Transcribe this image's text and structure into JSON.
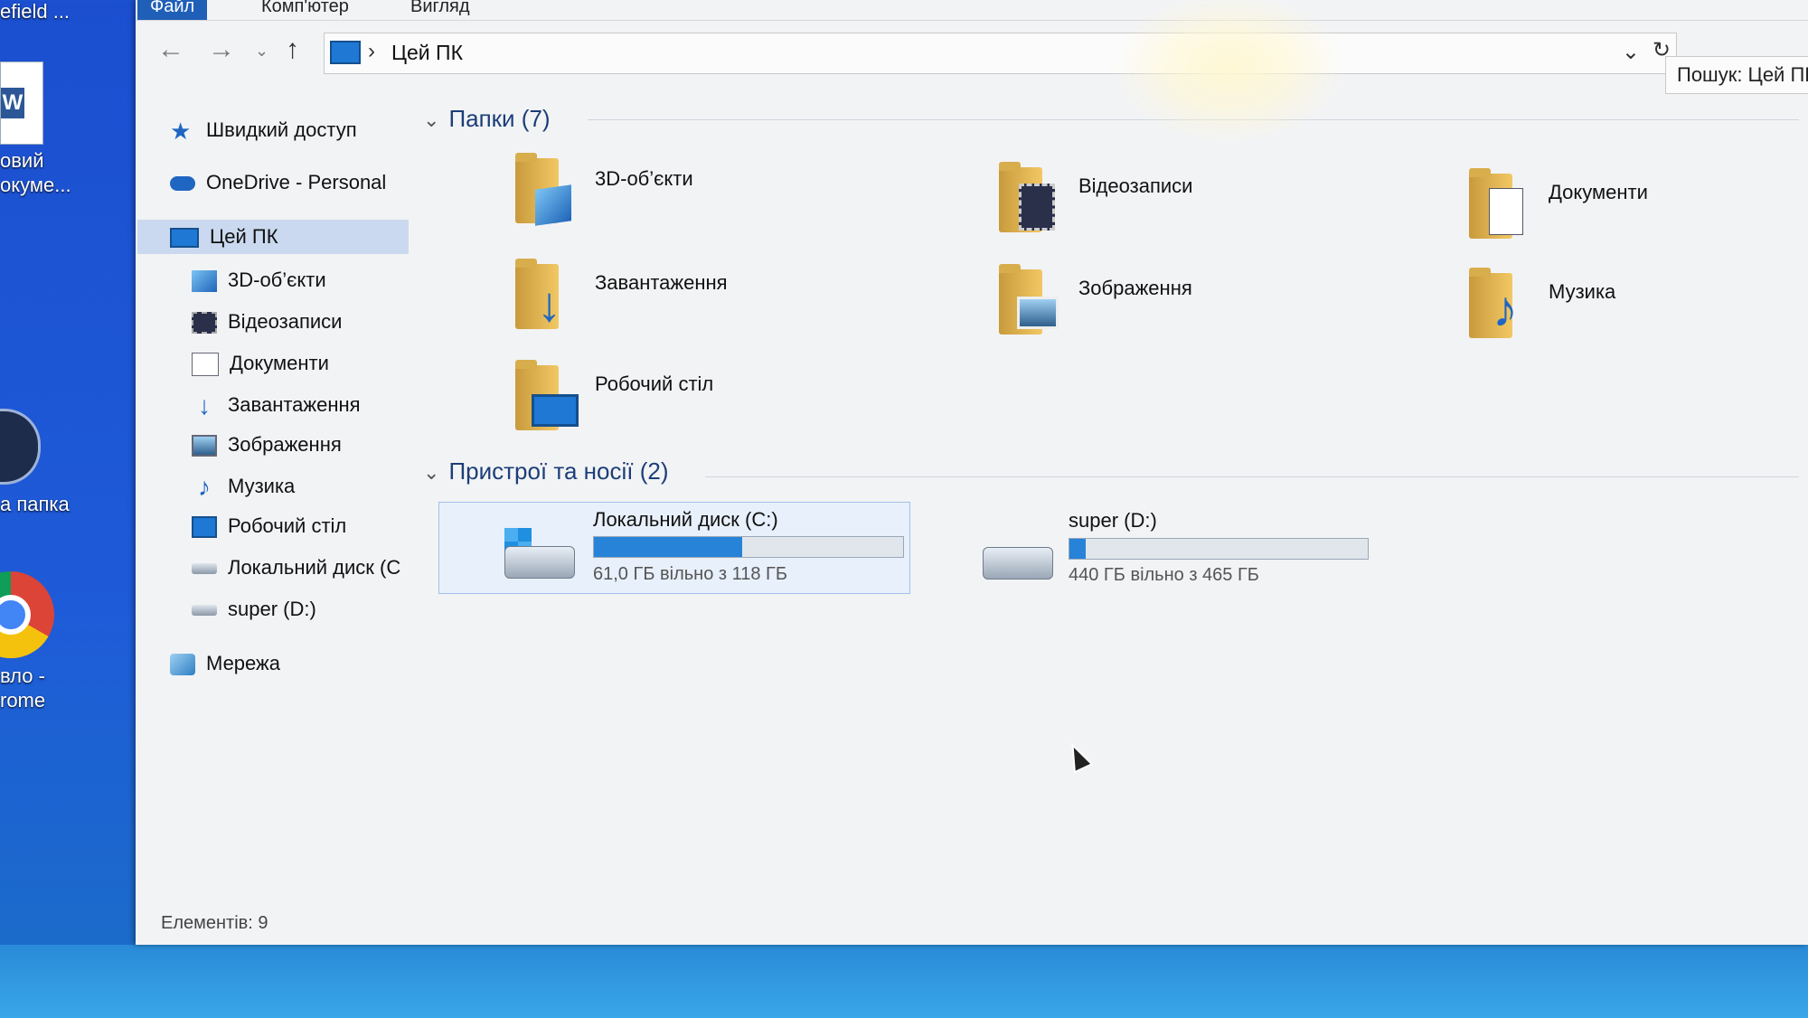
{
  "desktop": {
    "top_label": "efield ...",
    "word_label_1": "овий",
    "word_label_2": "окуме...",
    "folder_label": "а папка",
    "chrome_label_1": "вло -",
    "chrome_label_2": "rome"
  },
  "ribbon": {
    "tabs": [
      "Файл",
      "Комп'ютер",
      "Вигляд"
    ]
  },
  "address": {
    "path": "Цей ПК"
  },
  "search": {
    "placeholder": "Пошук: Цей ПК"
  },
  "sidebar": {
    "items": [
      {
        "label": "Швидкий доступ"
      },
      {
        "label": "OneDrive - Personal"
      },
      {
        "label": "Цей ПК"
      },
      {
        "label": "3D-об’єкти"
      },
      {
        "label": "Відеозаписи"
      },
      {
        "label": "Документи"
      },
      {
        "label": "Завантаження"
      },
      {
        "label": "Зображення"
      },
      {
        "label": "Музика"
      },
      {
        "label": "Робочий стіл"
      },
      {
        "label": "Локальний диск (C"
      },
      {
        "label": "super (D:)"
      },
      {
        "label": "Мережа"
      }
    ]
  },
  "folders_group": {
    "title": "Папки (7)"
  },
  "folders": [
    {
      "label": "3D-об’єкти"
    },
    {
      "label": "Відеозаписи"
    },
    {
      "label": "Документи"
    },
    {
      "label": "Завантаження"
    },
    {
      "label": "Зображення"
    },
    {
      "label": "Музика"
    },
    {
      "label": "Робочий стіл"
    }
  ],
  "devices_group": {
    "title": "Пристрої та носії (2)"
  },
  "drives": [
    {
      "name": "Локальний диск (C:)",
      "free_text": "61,0 ГБ вільно з 118 ГБ",
      "used_fraction": 0.48
    },
    {
      "name": "super (D:)",
      "free_text": "440 ГБ вільно з 465 ГБ",
      "used_fraction": 0.054
    }
  ],
  "status": {
    "text": "Елементів: 9"
  },
  "colors": {
    "accent": "#1f5fb8",
    "selection": "#cad9ef",
    "bar_fill": "#2683d8",
    "desktop": "#1e5bd8"
  }
}
